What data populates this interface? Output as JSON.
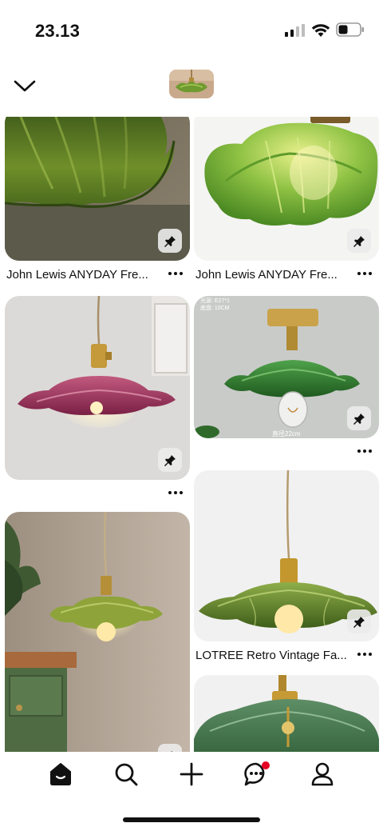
{
  "status": {
    "time": "23.13"
  },
  "header": {
    "back_icon": "chevron-down-icon",
    "thumbnail": "lamp-thumbnail"
  },
  "pins": {
    "left": [
      {
        "title": "John Lewis ANYDAY Fre...",
        "color": "#6b8a2e"
      },
      {
        "title": "",
        "color": "#8e2a55"
      },
      {
        "title": "",
        "color": "#8ea13a"
      }
    ],
    "right": [
      {
        "title": "John Lewis ANYDAY Fre...",
        "color": "#7fb33b"
      },
      {
        "title": "",
        "color": "#2f7a2c",
        "overlay_text": "光源: E27*1",
        "overlay_text2": "底盘: 10CM",
        "overlay_bottom": "直径22cm"
      },
      {
        "title": "LOTREE Retro Vintage Fa...",
        "color": "#5e7d27"
      },
      {
        "title": "",
        "color": "#3f6b46"
      }
    ]
  },
  "more_label": "⋯",
  "nav": {
    "items": [
      "home-icon",
      "search-icon",
      "create-icon",
      "messages-icon",
      "profile-icon"
    ],
    "notification_color": "#e60023"
  }
}
